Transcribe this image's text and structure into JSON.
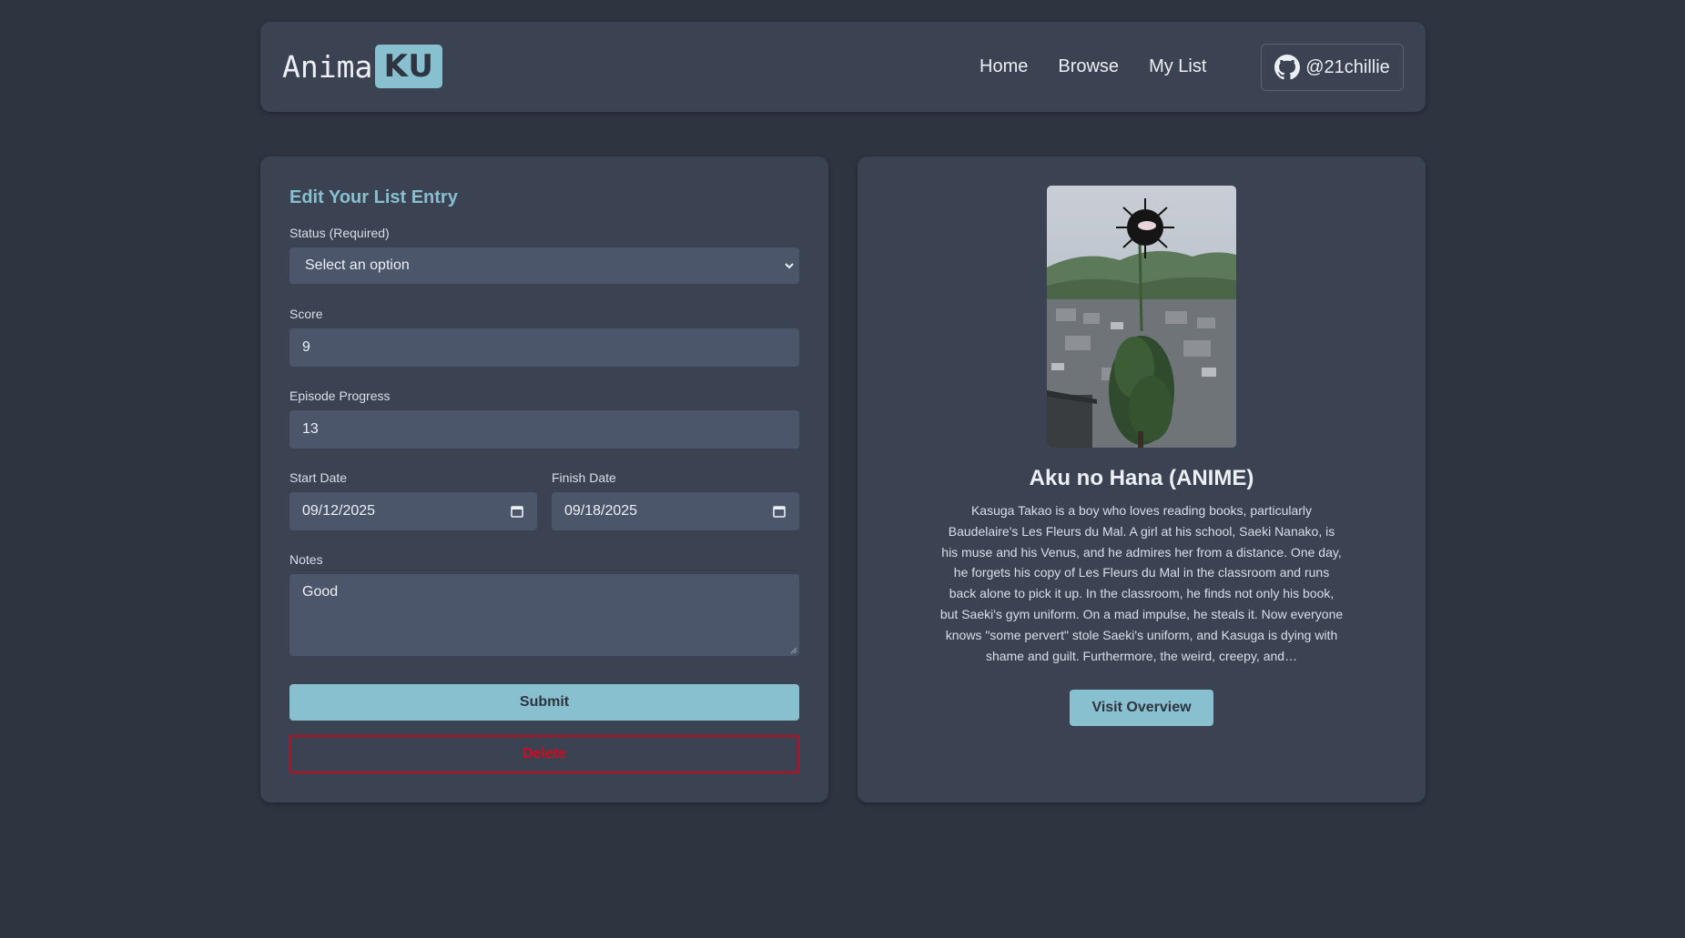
{
  "brand": {
    "name_plain": "Anima",
    "name_badge": "KU",
    "accent_color": "#88c0d0",
    "background_color": "#2e3440",
    "card_color": "#3b4252",
    "input_color": "#4c566a",
    "danger_color": "#bf0d1f"
  },
  "nav": {
    "links": [
      "Home",
      "Browse",
      "My List"
    ],
    "github_icon": "github-icon",
    "github_handle": "@21chillie"
  },
  "form": {
    "title": "Edit Your List Entry",
    "status": {
      "label": "Status (Required)",
      "selected": "Select an option",
      "icon": "chevron-down-icon"
    },
    "score": {
      "label": "Score",
      "value": "9"
    },
    "episode_progress": {
      "label": "Episode Progress",
      "value": "13"
    },
    "start_date": {
      "label": "Start Date",
      "value": "09/12/2025",
      "icon": "calendar-icon"
    },
    "finish_date": {
      "label": "Finish Date",
      "value": "09/18/2025",
      "icon": "calendar-icon"
    },
    "notes": {
      "label": "Notes",
      "value": "Good"
    },
    "submit_label": "Submit",
    "delete_label": "Delete"
  },
  "anime": {
    "title": "Aku no Hana (ANIME)",
    "synopsis": "Kasuga Takao is a boy who loves reading books, particularly Baudelaire's Les Fleurs du Mal. A girl at his school, Saeki Nanako, is his muse and his Venus, and he admires her from a distance. One day, he forgets his copy of Les Fleurs du Mal in the classroom and runs back alone to pick it up. In the classroom, he finds not only his book, but Saeki's gym uniform. On a mad impulse, he steals it. Now everyone knows \"some pervert\" stole Saeki's uniform, and Kasuga is dying with shame and guilt. Furthermore, the weird, creepy, and…",
    "overview_label": "Visit Overview"
  }
}
